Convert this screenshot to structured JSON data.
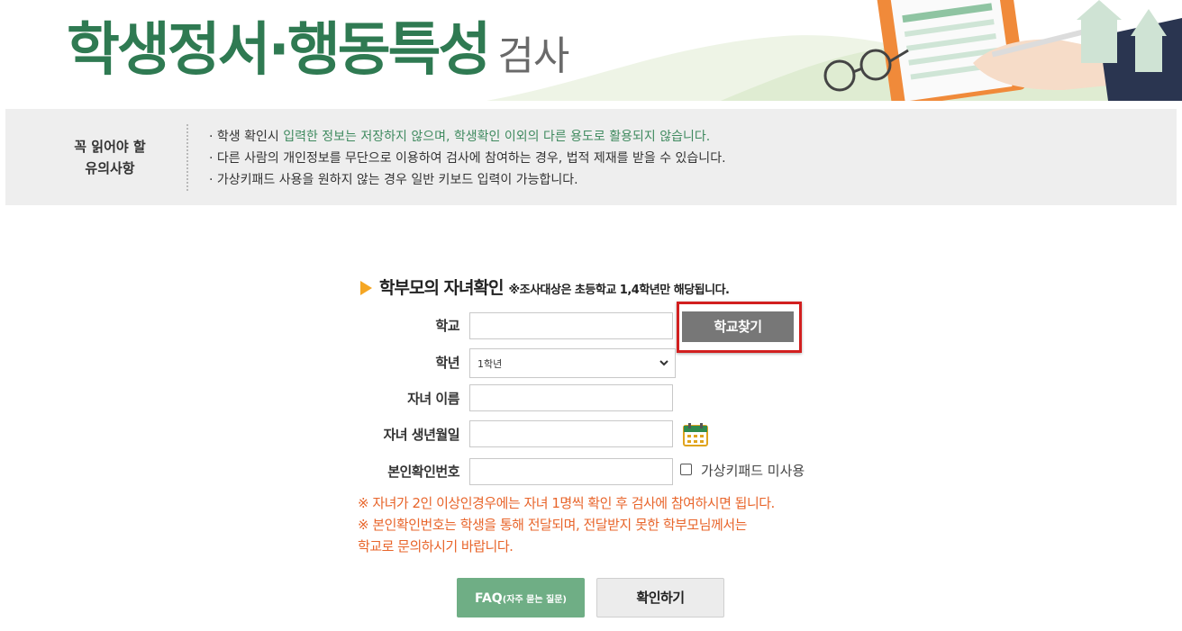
{
  "header": {
    "title_main": "학생정서·행동특성",
    "title_sub": "검사"
  },
  "notice": {
    "label_line1": "꼭 읽어야 할",
    "label_line2": "유의사항",
    "item1_a": "· 학생 확인시 ",
    "item1_b": "입력한 정보는 저장하지 않으며, 학생확인 이외의 다른 용도로 활용되지 않습니다.",
    "item2": "· 다른 사람의 개인정보를 무단으로 이용하여 검사에 참여하는 경우, 법적 제재를 받을 수 있습니다.",
    "item3": "· 가상키패드 사용을 원하지 않는 경우 일반 키보드 입력이 가능합니다."
  },
  "form": {
    "title": "학부모의 자녀확인",
    "note": "※조사대상은 초등학교 1,4학년만 해당됩니다.",
    "school_label": "학교",
    "school_value": "",
    "find_school_button": "학교찾기",
    "grade_label": "학년",
    "grade_selected": "1학년",
    "child_name_label": "자녀 이름",
    "child_name_value": "",
    "birthdate_label": "자녀 생년월일",
    "birthdate_value": "",
    "id_code_label": "본인확인번호",
    "id_code_value": "",
    "virtual_keypad_label": "가상키패드 미사용",
    "warnings": [
      "※ 자녀가 2인 이상인경우에는 자녀 1명씩 확인 후 검사에 참여하시면 됩니다.",
      "※ 본인확인번호는 학생을 통해 전달되며, 전달받지 못한 학부모님께서는",
      "학교로 문의하시기 바랍니다."
    ],
    "faq_button": "FAQ",
    "faq_button_sub": "(자주 묻는 질문)",
    "confirm_button": "확인하기"
  },
  "colors": {
    "brand_green": "#2f7a52",
    "highlight_red": "#d21f1f",
    "warning_orange": "#e8652b",
    "faq_green": "#6fae85"
  }
}
